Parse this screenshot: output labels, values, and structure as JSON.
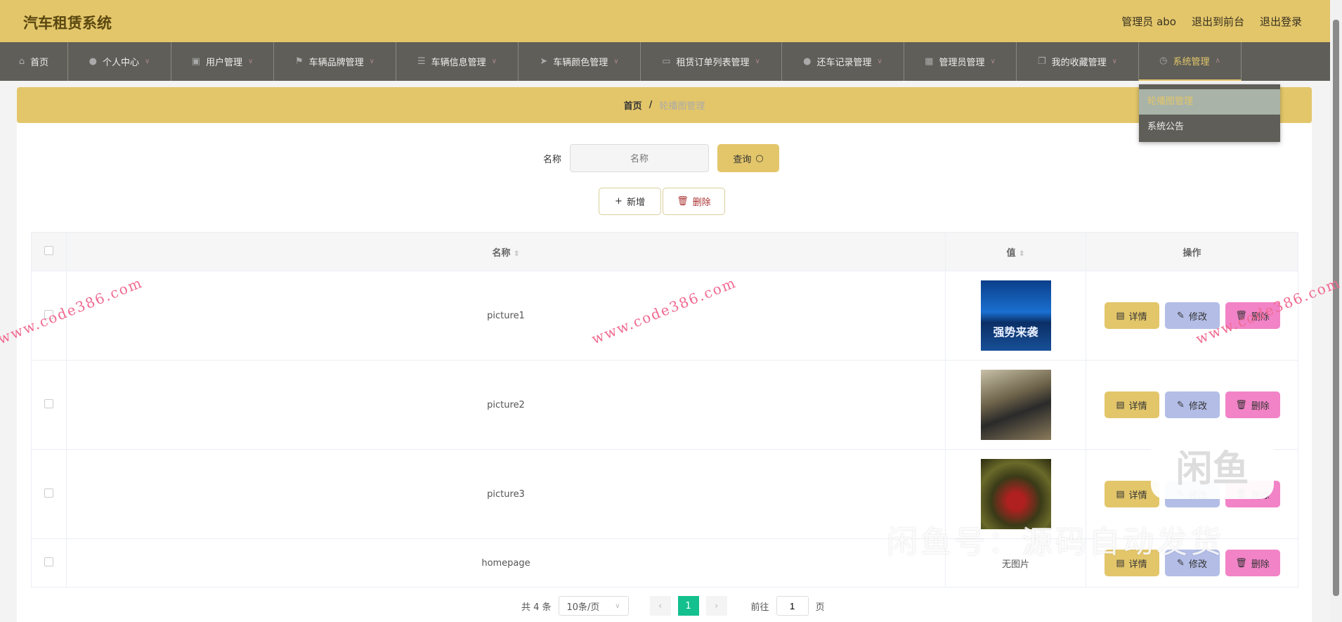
{
  "header": {
    "title": "汽车租赁系统",
    "user": "管理员 abo",
    "to_front": "退出到前台",
    "logout": "退出登录"
  },
  "nav": [
    {
      "label": "首页",
      "icon": "home-icon"
    },
    {
      "label": "个人中心",
      "icon": "user-icon"
    },
    {
      "label": "用户管理",
      "icon": "image-icon"
    },
    {
      "label": "车辆品牌管理",
      "icon": "flag-icon"
    },
    {
      "label": "车辆信息管理",
      "icon": "list-icon"
    },
    {
      "label": "车辆颜色管理",
      "icon": "send-icon"
    },
    {
      "label": "租赁订单列表管理",
      "icon": "chat-icon"
    },
    {
      "label": "还车记录管理",
      "icon": "user-icon"
    },
    {
      "label": "管理员管理",
      "icon": "grid-icon"
    },
    {
      "label": "我的收藏管理",
      "icon": "copy-icon"
    },
    {
      "label": "系统管理",
      "icon": "clock-icon"
    }
  ],
  "dropdown": [
    "轮播图管理",
    "系统公告"
  ],
  "breadcrumb": {
    "home": "首页",
    "sep": "/",
    "current": "轮播图管理"
  },
  "search": {
    "label": "名称",
    "placeholder": "名称",
    "button": "查询"
  },
  "actions": {
    "add": "新增",
    "delete": "删除"
  },
  "table": {
    "headers": {
      "name": "名称",
      "value": "值",
      "ops": "操作"
    },
    "rows": [
      {
        "name": "picture1",
        "value": "image",
        "no_image": ""
      },
      {
        "name": "picture2",
        "value": "image",
        "no_image": ""
      },
      {
        "name": "picture3",
        "value": "image",
        "no_image": ""
      },
      {
        "name": "homepage",
        "value": "none",
        "no_image": "无图片"
      }
    ],
    "row_actions": {
      "detail": "详情",
      "edit": "修改",
      "delete": "删除"
    },
    "img1_caption": "强势来袭"
  },
  "pagination": {
    "total": "共 4 条",
    "page_size": "10条/页",
    "current": "1",
    "goto": "前往",
    "goto_value": "1",
    "page_suffix": "页"
  },
  "watermark": {
    "site": "www.code386.com",
    "xianyu": "闲鱼号：源码自动发货",
    "logo": "闲鱼"
  },
  "colors": {
    "primary": "#e3c66a",
    "nav": "#5f5e58",
    "edit": "#b3bde6",
    "danger": "#f283c7",
    "page_active": "#13c08e"
  }
}
